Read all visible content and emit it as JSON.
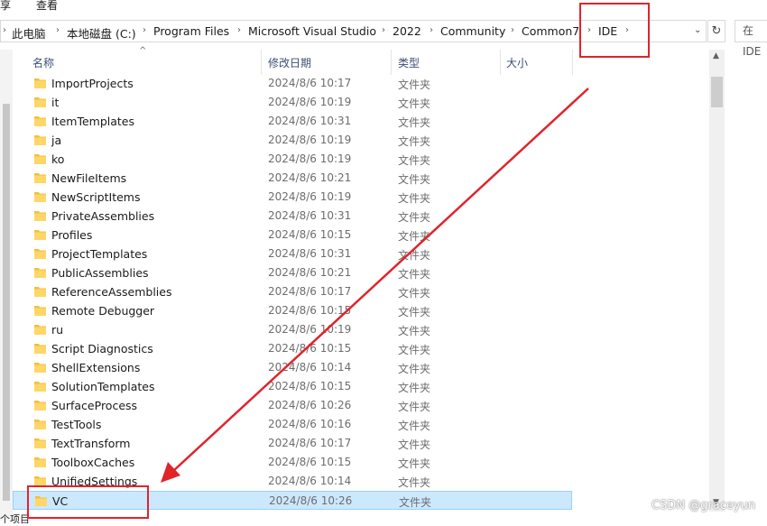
{
  "menu": {
    "share": "享",
    "view": "查看"
  },
  "address": {
    "crumbs": [
      "此电脑",
      "本地磁盘 (C:)",
      "Program Files",
      "Microsoft Visual Studio",
      "2022",
      "Community",
      "Common7",
      "IDE"
    ],
    "search_placeholder": "在 IDE"
  },
  "columns": {
    "name": "名称",
    "date": "修改日期",
    "type": "类型",
    "size": "大小"
  },
  "files": [
    {
      "name": "ImportProjects",
      "date": "2024/8/6 10:17",
      "type": "文件夹"
    },
    {
      "name": "it",
      "date": "2024/8/6 10:19",
      "type": "文件夹"
    },
    {
      "name": "ItemTemplates",
      "date": "2024/8/6 10:31",
      "type": "文件夹"
    },
    {
      "name": "ja",
      "date": "2024/8/6 10:19",
      "type": "文件夹"
    },
    {
      "name": "ko",
      "date": "2024/8/6 10:19",
      "type": "文件夹"
    },
    {
      "name": "NewFileItems",
      "date": "2024/8/6 10:21",
      "type": "文件夹"
    },
    {
      "name": "NewScriptItems",
      "date": "2024/8/6 10:19",
      "type": "文件夹"
    },
    {
      "name": "PrivateAssemblies",
      "date": "2024/8/6 10:31",
      "type": "文件夹"
    },
    {
      "name": "Profiles",
      "date": "2024/8/6 10:15",
      "type": "文件夹"
    },
    {
      "name": "ProjectTemplates",
      "date": "2024/8/6 10:31",
      "type": "文件夹"
    },
    {
      "name": "PublicAssemblies",
      "date": "2024/8/6 10:21",
      "type": "文件夹"
    },
    {
      "name": "ReferenceAssemblies",
      "date": "2024/8/6 10:17",
      "type": "文件夹"
    },
    {
      "name": "Remote Debugger",
      "date": "2024/8/6 10:15",
      "type": "文件夹"
    },
    {
      "name": "ru",
      "date": "2024/8/6 10:19",
      "type": "文件夹"
    },
    {
      "name": "Script Diagnostics",
      "date": "2024/8/6 10:15",
      "type": "文件夹"
    },
    {
      "name": "ShellExtensions",
      "date": "2024/8/6 10:14",
      "type": "文件夹"
    },
    {
      "name": "SolutionTemplates",
      "date": "2024/8/6 10:15",
      "type": "文件夹"
    },
    {
      "name": "SurfaceProcess",
      "date": "2024/8/6 10:26",
      "type": "文件夹"
    },
    {
      "name": "TestTools",
      "date": "2024/8/6 10:16",
      "type": "文件夹"
    },
    {
      "name": "TextTransform",
      "date": "2024/8/6 10:17",
      "type": "文件夹"
    },
    {
      "name": "ToolboxCaches",
      "date": "2024/8/6 10:15",
      "type": "文件夹"
    },
    {
      "name": "UnifiedSettings",
      "date": "2024/8/6 10:14",
      "type": "文件夹"
    },
    {
      "name": "VC",
      "date": "2024/8/6 10:26",
      "type": "文件夹",
      "selected": true
    }
  ],
  "status": {
    "items_label": "个项目"
  },
  "watermark": "CSDN @graceyun",
  "colors": {
    "highlight": "#e0242a",
    "selection": "#cce8ff",
    "folder": "#f3c03b"
  }
}
